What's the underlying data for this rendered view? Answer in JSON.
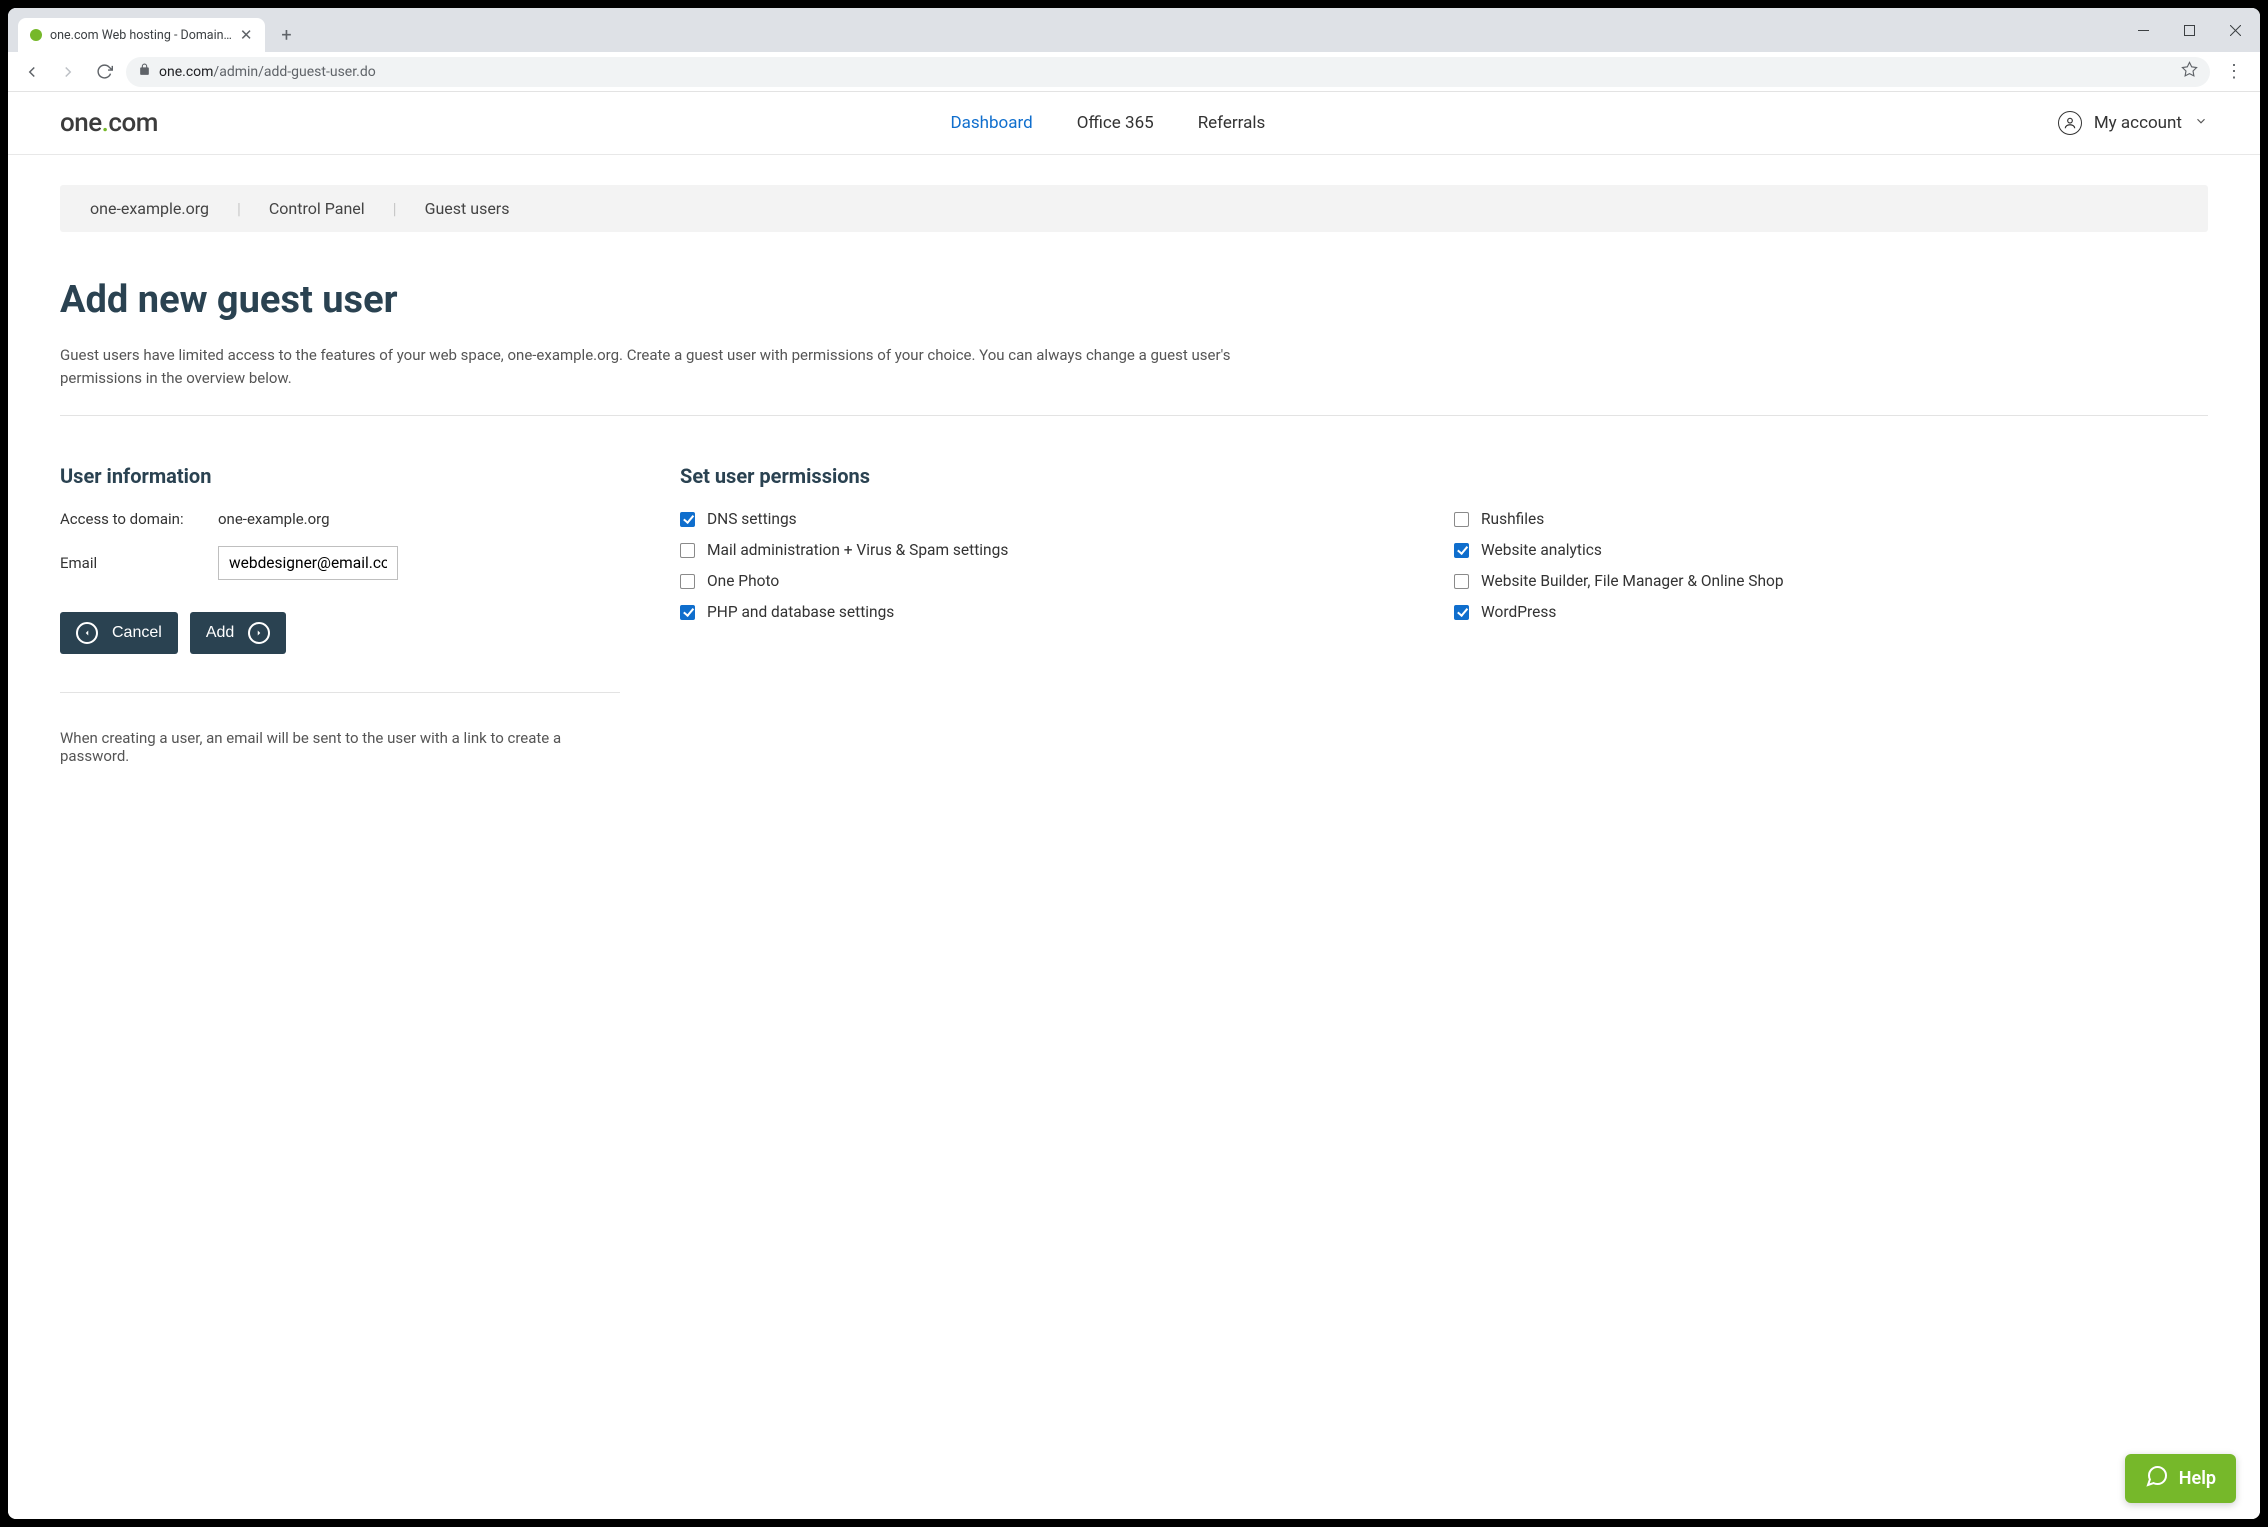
{
  "browser": {
    "tab_title": "one.com Web hosting  -  Domain…",
    "url_host": "one.com",
    "url_path": "/admin/add-guest-user.do"
  },
  "header": {
    "logo_left": "one",
    "logo_right": "com",
    "nav": {
      "dashboard": "Dashboard",
      "office": "Office 365",
      "referrals": "Referrals"
    },
    "account_label": "My account"
  },
  "breadcrumb": {
    "domain": "one-example.org",
    "control_panel": "Control Panel",
    "guest_users": "Guest users"
  },
  "page_title": "Add new guest user",
  "description": "Guest users have limited access to the features of your web space, one-example.org. Create a guest user with permissions of your choice. You can always change a guest user's permissions in the overview below.",
  "user_info": {
    "heading": "User information",
    "access_label": "Access to domain:",
    "access_value": "one-example.org",
    "email_label": "Email",
    "email_value": "webdesigner@email.com"
  },
  "buttons": {
    "cancel": "Cancel",
    "add": "Add"
  },
  "permissions": {
    "heading": "Set user permissions",
    "left": [
      {
        "label": "DNS settings",
        "checked": true
      },
      {
        "label": "Mail administration + Virus & Spam settings",
        "checked": false
      },
      {
        "label": "One Photo",
        "checked": false
      },
      {
        "label": "PHP and database settings",
        "checked": true
      }
    ],
    "right": [
      {
        "label": "Rushfiles",
        "checked": false
      },
      {
        "label": "Website analytics",
        "checked": true
      },
      {
        "label": "Website Builder, File Manager & Online Shop",
        "checked": false
      },
      {
        "label": "WordPress",
        "checked": true
      }
    ]
  },
  "note": "When creating a user, an email will be sent to the user with a link to create a password.",
  "help_label": "Help"
}
